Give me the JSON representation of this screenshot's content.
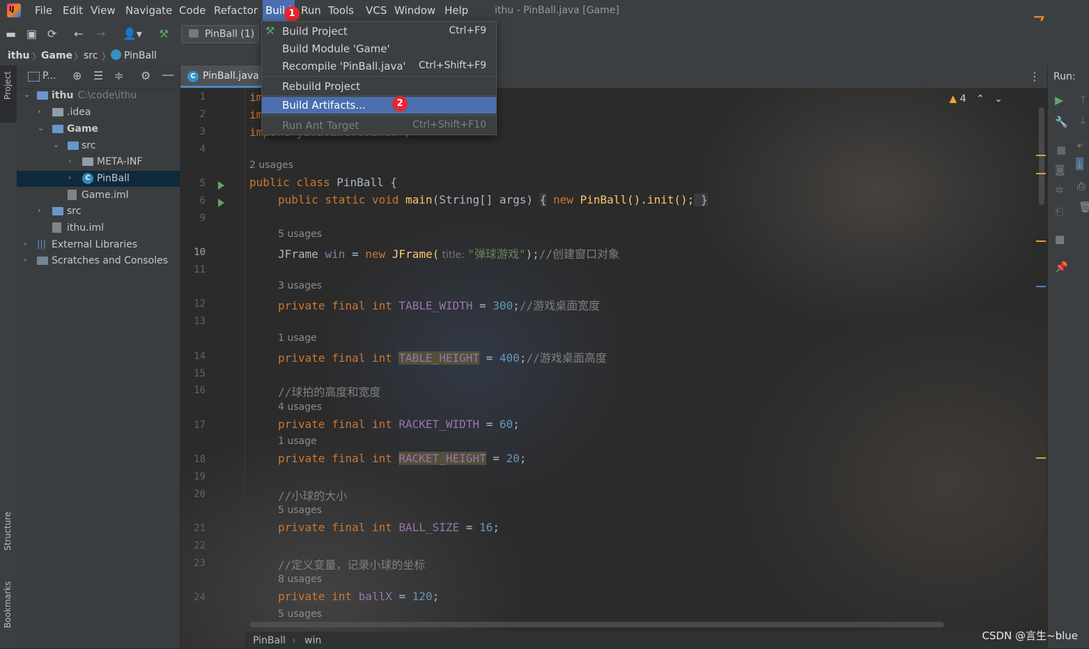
{
  "menubar": {
    "items": [
      "File",
      "Edit",
      "View",
      "Navigate",
      "Code",
      "Refactor",
      "Build",
      "Run",
      "Tools",
      "VCS",
      "Window",
      "Help"
    ],
    "window_title": "ithu - PinBall.java [Game]",
    "corner_number": "7"
  },
  "toolbar": {
    "run_config": "PinBall (1)"
  },
  "breadcrumb": [
    "ithu",
    "Game",
    "src",
    "PinBall"
  ],
  "left_stripe": {
    "project": "Project",
    "structure": "Structure",
    "bookmarks": "Bookmarks"
  },
  "project_panel": {
    "header_label": "P...",
    "tree": [
      {
        "label": "ithu",
        "extra": "C:\\code\\ithu",
        "bold": true
      },
      {
        "label": ".idea"
      },
      {
        "label": "Game",
        "bold": true
      },
      {
        "label": "src"
      },
      {
        "label": "META-INF"
      },
      {
        "label": "PinBall"
      },
      {
        "label": "Game.iml"
      },
      {
        "label": "src"
      },
      {
        "label": "ithu.iml"
      },
      {
        "label": "External Libraries"
      },
      {
        "label": "Scratches and Consoles"
      }
    ]
  },
  "editor": {
    "tab": "PinBall.java",
    "warnings": "4",
    "line_numbers": [
      "1",
      "2",
      "3",
      "4",
      "5",
      "6",
      "9",
      "10",
      "11",
      "12",
      "13",
      "14",
      "15",
      "16",
      "17",
      "18",
      "19",
      "20",
      "21",
      "22",
      "23",
      "24"
    ],
    "code": {
      "l1": "im",
      "l2": "im",
      "l3": "import java.awt.event.*;",
      "u5": "2 usages",
      "l5a": "public class ",
      "l5b": "PinBall {",
      "l6a": "public static void ",
      "l6b": "main",
      "l6c": "(String[] args) ",
      "l6d": "{",
      "l6e": " new ",
      "l6f": "PinBall().init();",
      "l6g": " }",
      "u10": "5 usages",
      "l10a": "JFrame ",
      "l10b": "win",
      "l10c": " = ",
      "l10d": "new ",
      "l10e": "JFrame(",
      "l10f": " title: ",
      "l10g": "\"弹球游戏\"",
      "l10h": ");",
      "l10i": "//创建窗口对象",
      "u12": "3 usages",
      "l12a": "private final int ",
      "l12b": "TABLE_WIDTH",
      "l12c": " = ",
      "l12d": "300",
      "l12e": ";",
      "l12f": "//游戏桌面宽度",
      "u14": "1 usage",
      "l14a": "private final int ",
      "l14b": "TABLE_HEIGHT",
      "l14c": " = ",
      "l14d": "400",
      "l14e": ";",
      "l14f": "//游戏桌面高度",
      "l16": "//球拍的高度和宽度",
      "u17": "4 usages",
      "l17a": "private final int ",
      "l17b": "RACKET_WIDTH",
      "l17c": " = ",
      "l17d": "60",
      "l17e": ";",
      "u18": "1 usage",
      "l18a": "private final int ",
      "l18b": "RACKET_HEIGHT",
      "l18c": " = ",
      "l18d": "20",
      "l18e": ";",
      "l20": "//小球的大小",
      "u21": "5 usages",
      "l21a": "private final int ",
      "l21b": "BALL_SIZE",
      "l21c": " = ",
      "l21d": "16",
      "l21e": ";",
      "l23": "//定义变量，记录小球的坐标",
      "u24": "8 usages",
      "l24a": "private int ",
      "l24b": "ballX",
      "l24c": " = ",
      "l24d": "120",
      "l24e": ";",
      "u25": "5 usages"
    },
    "footer": [
      "PinBall",
      "win"
    ]
  },
  "run_panel": {
    "label": "Run:"
  },
  "build_menu": {
    "items": [
      {
        "label": "Build Project",
        "shortcut": "Ctrl+F9"
      },
      {
        "label": "Build Module 'Game'",
        "shortcut": ""
      },
      {
        "label": "Recompile 'PinBall.java'",
        "shortcut": "Ctrl+Shift+F9"
      },
      {
        "label": "Rebuild Project",
        "shortcut": ""
      },
      {
        "label": "Build Artifacts...",
        "shortcut": ""
      },
      {
        "label": "Run Ant Target",
        "shortcut": "Ctrl+Shift+F10"
      }
    ],
    "badges": [
      "1",
      "2"
    ]
  },
  "watermark": "CSDN @言生~blue",
  "colors": {
    "accent": "#4b6eaf",
    "badge": "#e8262e",
    "keyword": "#cc7832",
    "field": "#9876aa",
    "number": "#6897bb"
  }
}
